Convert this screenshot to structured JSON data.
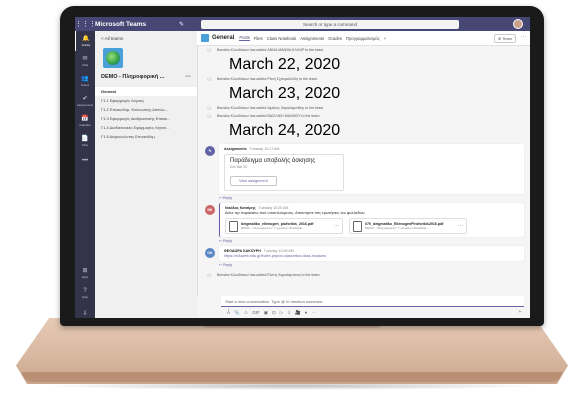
{
  "app": {
    "name": "Microsoft Teams",
    "search_placeholder": "Search or type a command"
  },
  "appbar": [
    {
      "icon": "bell-icon",
      "label": "Activity",
      "glyph": "🔔"
    },
    {
      "icon": "chat-icon",
      "label": "Chat",
      "glyph": "✉"
    },
    {
      "icon": "teams-icon",
      "label": "Teams",
      "glyph": "👥"
    },
    {
      "icon": "assignments-icon",
      "label": "Assignments",
      "glyph": "✔"
    },
    {
      "icon": "calendar-icon",
      "label": "Calendar",
      "glyph": "📅"
    },
    {
      "icon": "files-icon",
      "label": "Files",
      "glyph": "📄"
    },
    {
      "icon": "more-icon",
      "label": "",
      "glyph": "•••"
    },
    {
      "icon": "apps-icon",
      "label": "Apps",
      "glyph": "⊞"
    },
    {
      "icon": "help-icon",
      "label": "Help",
      "glyph": "?"
    },
    {
      "icon": "download-icon",
      "label": "",
      "glyph": "⇩"
    }
  ],
  "sidebar": {
    "back_label": "< All teams",
    "team_name": "DEMO - Πληροφορική ...",
    "team_more": "···",
    "channels": [
      "General",
      "Γ1.1 Εφαρμογές Λόγους",
      "Γ1.2 Εποικοδόμ. Κοινωνικής Δικτύω...",
      "Γ1.3 Εφαρμογές Διαδραστικής Επικοι...",
      "Γ1.4 Διαδικτυακές Εφαρμογές Λέγετε...",
      "Γ1.5 Διερευνώντας Εποικοδόμ."
    ]
  },
  "channel_header": {
    "title": "General",
    "tabs": [
      "Posts",
      "Files",
      "Class Notebook",
      "Assignments",
      "Grades",
      "Προγραμματισμός",
      "+"
    ],
    "team_button": "⊕ Team",
    "more": "···"
  },
  "feed": {
    "system_messages": [
      {
        "text": "Βασιλίκι Κλουδάκου has added ΑΝΝΑ ΜΑΝΘΑ ΚΛΛΩΡ to the team.",
        "date": "March 22, 2020"
      },
      {
        "text": "Βασιλίκι Κλουδάκου has added Ράνη Σχινοράλλιδη to the team.",
        "date": "March 23, 2020"
      },
      {
        "text": "Βασιλίκι Κλουδάκου has added Αιμίλιος Χαραλαμπίδης to the team.",
        "date": ""
      },
      {
        "text": "Βασιλίκι Κλουδάκου has added ΒΑΣΙΛΙΚΗ ΜΑΝΘΟΥ to the team.",
        "date": "March 24, 2020"
      }
    ],
    "assignment_post": {
      "author": "Assignments",
      "time": "Tuesday 10:17 AM",
      "title": "Παράδειγμα υποβολής άσκησης",
      "due": "Due Mar 25",
      "button": "View assignment",
      "reply": "↩ Reply"
    },
    "nk_post": {
      "initials": "NK",
      "author": "Νικόλας Κοτσίρης",
      "time": "Tuesday 10:20 AM",
      "message": "Δείτε την παρακάτω πού υποτιτλούμενες. Απαντήστε στις ερωτήσεις του φυλλαδίου.",
      "attachments": [
        {
          "name": "deigmatiko_ellenogen_ploforikis_2016.pdf",
          "path": "DEMO - Πληροφορική Γ' Γυμνασίου Φυλλάδια..."
        },
        {
          "name": "070_deigmatiko_EllenogenPlroforikis2016.pdf",
          "path": "DEMO - Πληροφορική Γ' Γυμνασίου Φυλλάδια..."
        }
      ],
      "reply": "↩ Reply"
    },
    "ok_post": {
      "initials": "OK",
      "author": "ΘΕΟΔΩΡΑ ΚΑΚΟΥΡΗ",
      "time": "Tuesday 10:59 AM",
      "link": "https://eduweb.edu.gr/index.php/xx-class/ekw-class-modules",
      "reply": "↩ Reply"
    },
    "last_system": "Βασιλίκι Κλουδάκου has added Ελένη Χαραλάμπους to the team."
  },
  "compose": {
    "placeholder": "Start a new conversation. Type @ to mention someone.",
    "tools": [
      "Aͯ",
      "📎",
      "☺",
      "GIF",
      "▣",
      "⊡",
      "▷",
      "⇩",
      "🎥",
      "●",
      "···"
    ],
    "send": "➢"
  },
  "colors": {
    "titlebar": "#464775",
    "appbar": "#33344a",
    "accent": "#6264a7",
    "laptop_base": "#e0c2ac"
  }
}
